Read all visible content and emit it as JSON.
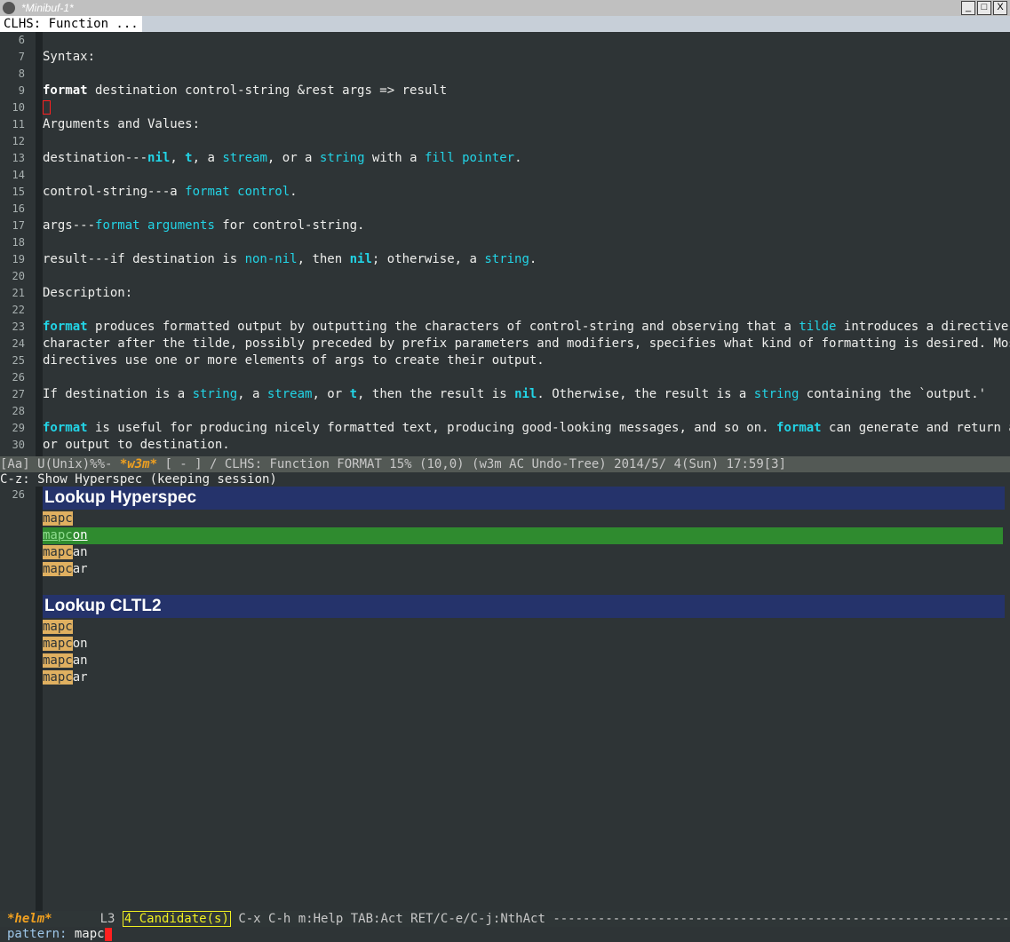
{
  "window": {
    "title": "*Minibuf-1*",
    "buttons": [
      "_",
      "□",
      "X"
    ]
  },
  "tab": {
    "label": "CLHS: Function ..."
  },
  "doc_lines": [
    {
      "n": "6",
      "parts": []
    },
    {
      "n": "7",
      "parts": [
        [
          "Syntax:",
          ""
        ]
      ]
    },
    {
      "n": "8",
      "parts": []
    },
    {
      "n": "9",
      "parts": [
        [
          "format",
          "k"
        ],
        [
          " destination control-string &rest args => result",
          ""
        ]
      ]
    },
    {
      "n": "10",
      "parts": [],
      "cursor": true
    },
    {
      "n": "11",
      "parts": [
        [
          "Arguments and Values:",
          ""
        ]
      ]
    },
    {
      "n": "12",
      "parts": []
    },
    {
      "n": "13",
      "parts": [
        [
          "destination---",
          ""
        ],
        [
          "nil",
          "lkb"
        ],
        [
          ", ",
          ""
        ],
        [
          "t",
          "lkb"
        ],
        [
          ", a ",
          ""
        ],
        [
          "stream",
          "lk"
        ],
        [
          ", or a ",
          ""
        ],
        [
          "string",
          "lk"
        ],
        [
          " with a ",
          ""
        ],
        [
          "fill pointer",
          "lk"
        ],
        [
          ".",
          ""
        ]
      ]
    },
    {
      "n": "14",
      "parts": []
    },
    {
      "n": "15",
      "parts": [
        [
          "control-string---a ",
          ""
        ],
        [
          "format control",
          "lk"
        ],
        [
          ".",
          ""
        ]
      ]
    },
    {
      "n": "16",
      "parts": []
    },
    {
      "n": "17",
      "parts": [
        [
          "args---",
          ""
        ],
        [
          "format arguments",
          "lk"
        ],
        [
          " for control-string.",
          ""
        ]
      ]
    },
    {
      "n": "18",
      "parts": []
    },
    {
      "n": "19",
      "parts": [
        [
          "result---if destination is ",
          ""
        ],
        [
          "non-nil",
          "lk"
        ],
        [
          ", then ",
          ""
        ],
        [
          "nil",
          "lkb"
        ],
        [
          "; otherwise, a ",
          ""
        ],
        [
          "string",
          "lk"
        ],
        [
          ".",
          ""
        ]
      ]
    },
    {
      "n": "20",
      "parts": []
    },
    {
      "n": "21",
      "parts": [
        [
          "Description:",
          ""
        ]
      ]
    },
    {
      "n": "22",
      "parts": []
    },
    {
      "n": "23",
      "parts": [
        [
          "format",
          "lkb"
        ],
        [
          " produces formatted output by outputting the characters of control-string and observing that a ",
          ""
        ],
        [
          "tilde",
          "lk"
        ],
        [
          " introduces a directive. The",
          ""
        ]
      ]
    },
    {
      "n": "24",
      "parts": [
        [
          "character after the tilde, possibly preceded by prefix parameters and modifiers, specifies what kind of formatting is desired. Most",
          ""
        ]
      ]
    },
    {
      "n": "25",
      "parts": [
        [
          "directives use one or more elements of args to create their output.",
          ""
        ]
      ]
    },
    {
      "n": "26",
      "parts": []
    },
    {
      "n": "27",
      "parts": [
        [
          "If destination is a ",
          ""
        ],
        [
          "string",
          "lk"
        ],
        [
          ", a ",
          ""
        ],
        [
          "stream",
          "lk"
        ],
        [
          ", or ",
          ""
        ],
        [
          "t",
          "lkb"
        ],
        [
          ", then the result is ",
          ""
        ],
        [
          "nil",
          "lkb"
        ],
        [
          ". Otherwise, the result is a ",
          ""
        ],
        [
          "string",
          "lk"
        ],
        [
          " containing the `output.'",
          ""
        ]
      ]
    },
    {
      "n": "28",
      "parts": []
    },
    {
      "n": "29",
      "parts": [
        [
          "format",
          "lkb"
        ],
        [
          " is useful for producing nicely formatted text, producing good-looking messages, and so on. ",
          ""
        ],
        [
          "format",
          "lkb"
        ],
        [
          " can generate and return a ",
          ""
        ],
        [
          "stri",
          "lk"
        ]
      ]
    },
    {
      "n": "30",
      "parts": [
        [
          "or output to destination.",
          ""
        ]
      ]
    }
  ],
  "modeline": {
    "prefix": "[Aa] U(Unix)%%-  ",
    "buffer": "*w3m*",
    "rest": " [ - ] / CLHS: Function FORMAT   15% (10,0)     (w3m AC Undo-Tree) 2014/5/ 4(Sun) 17:59[3]"
  },
  "echo": {
    "text": " C-z: Show Hyperspec (keeping session)"
  },
  "helm": {
    "line_number": "26",
    "pattern": "mapc",
    "sections": [
      {
        "title": "Lookup Hyperspec",
        "items": [
          {
            "match": "mapc",
            "rest": "",
            "selected": false
          },
          {
            "match": "mapc",
            "rest": "on ",
            "selected": true
          },
          {
            "match": "mapc",
            "rest": "an",
            "selected": false
          },
          {
            "match": "mapc",
            "rest": "ar",
            "selected": false
          }
        ]
      },
      {
        "title": "Lookup CLTL2",
        "items": [
          {
            "match": "mapc",
            "rest": "",
            "selected": false
          },
          {
            "match": "mapc",
            "rest": "on",
            "selected": false
          },
          {
            "match": "mapc",
            "rest": "an",
            "selected": false
          },
          {
            "match": "mapc",
            "rest": "ar",
            "selected": false
          }
        ]
      }
    ]
  },
  "helm_modeline": {
    "buffer": "*helm*",
    "line": "L3",
    "candidates": "4 Candidate(s)",
    "help": " C-x C-h m:Help TAB:Act RET/C-e/C-j:NthAct -------------------------------------------------------------"
  },
  "minibuffer": {
    "prompt": "pattern:",
    "input": " mapc"
  }
}
